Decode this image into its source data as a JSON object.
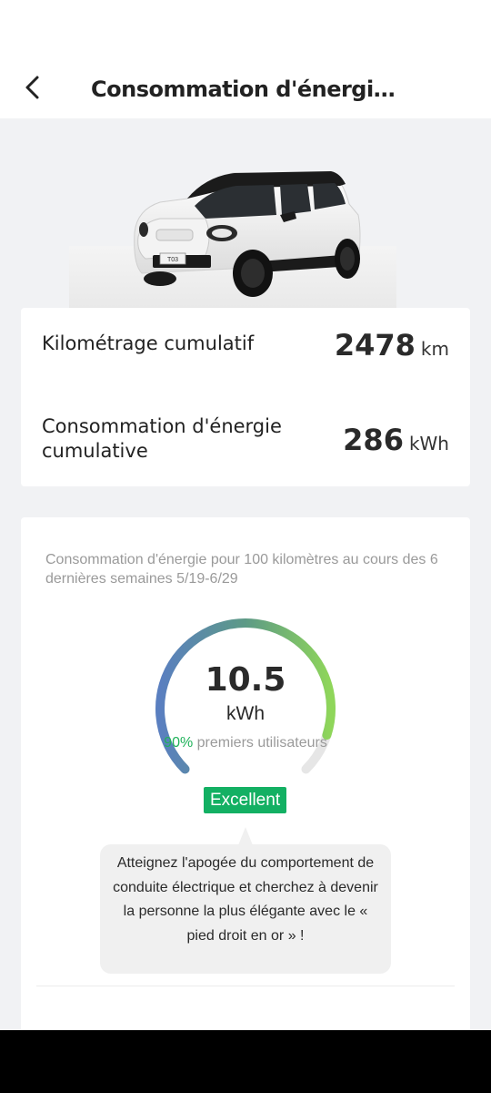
{
  "header": {
    "title": "Consommation d'énergie a…"
  },
  "vehicle": {
    "plate": "T03"
  },
  "stats": {
    "mileage_label": "Kilométrage cumulatif",
    "mileage_value": "2478",
    "mileage_unit": "km",
    "energy_label": "Consommation d'énergie cumulative",
    "energy_value": "286",
    "energy_unit": "kWh"
  },
  "consumption": {
    "description": "Consommation d'énergie pour 100 kilomètres au cours des 6 dernières semaines 5/19-6/29",
    "value": "10.5",
    "unit": "kWh",
    "rank_percent": "90%",
    "rank_text": "premiers utilisateurs",
    "rating": "Excellent",
    "gauge_fraction": 0.9,
    "tip": "Atteignez l'apogée du comportement de conduite électrique et cherchez à devenir la personne la plus élégante avec le « pied droit en or » !"
  },
  "colors": {
    "accent_green": "#13b063",
    "gauge_start": "#5a7fc0",
    "gauge_end": "#8fd65a",
    "gauge_track": "#e6e6e6"
  },
  "icons": {
    "back": "chevron-left-icon"
  }
}
